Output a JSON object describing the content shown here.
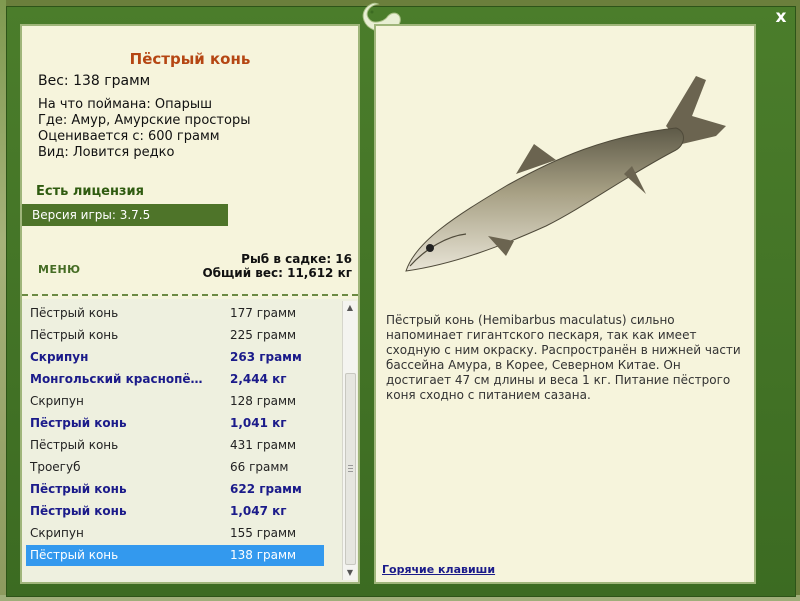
{
  "fish": {
    "name": "Пёстрый конь",
    "weight_line": "Вес: 138 грамм",
    "bait_line": "На что поймана: Опарыш",
    "location_line": "Где: Амур, Амурские просторы",
    "value_line": "Оценивается с: 600 грамм",
    "species_line": "Вид: Ловится редко",
    "description": "Пёстрый конь (Hemibarbus maculatus) сильно напоминает гигантского пескаря, так как имеет сходную с ним окраску. Распространён в нижней части бассейна Амура, в Корее, Северном Китае. Он достигает 47 см длины и веса 1 кг. Питание пёстрого коня сходно с питанием сазана."
  },
  "license_text": "Есть лицензия",
  "version_text": "Версия игры: 3.7.5",
  "menu_label": "МЕНЮ",
  "catch_count": "Рыб в садке: 16",
  "total_weight": "Общий вес: 11,612 кг",
  "hotkeys_label": "Горячие клавиши",
  "close_label": "x",
  "catch_list": [
    {
      "name": "Пёстрый конь",
      "weight": "177 грамм",
      "bold": false
    },
    {
      "name": "Пёстрый конь",
      "weight": "225 грамм",
      "bold": false
    },
    {
      "name": "Скрипун",
      "weight": "263 грамм",
      "bold": true
    },
    {
      "name": "Монгольский краснопё…",
      "weight": "2,444 кг",
      "bold": true
    },
    {
      "name": "Скрипун",
      "weight": "128 грамм",
      "bold": false
    },
    {
      "name": "Пёстрый конь",
      "weight": "1,041 кг",
      "bold": true
    },
    {
      "name": "Пёстрый конь",
      "weight": "431 грамм",
      "bold": false
    },
    {
      "name": "Троегуб",
      "weight": "66 грамм",
      "bold": false
    },
    {
      "name": "Пёстрый конь",
      "weight": "622 грамм",
      "bold": true
    },
    {
      "name": "Пёстрый конь",
      "weight": "1,047 кг",
      "bold": true
    },
    {
      "name": "Скрипун",
      "weight": "155 грамм",
      "bold": false
    },
    {
      "name": "Пёстрый конь",
      "weight": "138 грамм",
      "bold": false,
      "selected": true
    }
  ],
  "colors": {
    "title": "#b54613",
    "accent_green": "#4e7429",
    "selection": "#3399ee",
    "bold_text": "#1b1b8a"
  }
}
